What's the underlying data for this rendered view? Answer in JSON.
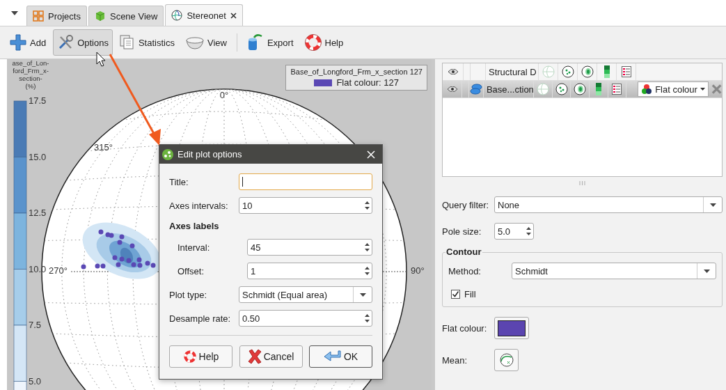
{
  "tabs": [
    {
      "label": "Projects",
      "kind": "projects",
      "selected": false
    },
    {
      "label": "Scene View",
      "kind": "scene",
      "selected": false
    },
    {
      "label": "Stereonet",
      "kind": "stereonet",
      "selected": true
    }
  ],
  "toolbar": [
    {
      "label": "Add",
      "kind": "add",
      "pressed": false
    },
    {
      "label": "Options",
      "kind": "options",
      "pressed": true
    },
    {
      "label": "Statistics",
      "kind": "statistics",
      "pressed": false
    },
    {
      "label": "View",
      "kind": "view",
      "pressed": false
    },
    {
      "label": "Export",
      "kind": "export",
      "pressed": false
    },
    {
      "label": "Help",
      "kind": "help",
      "pressed": false
    }
  ],
  "colorbar": {
    "title_lines": [
      "ase_of_Lon-",
      "ford_Frm_x-",
      "section-",
      "(%)"
    ],
    "ticks": [
      "17.5",
      "15.0",
      "12.5",
      "10.0",
      "7.5",
      "5.0"
    ]
  },
  "stereonet": {
    "labels": [
      {
        "text": "0°"
      },
      {
        "text": "315°"
      },
      {
        "text": "270°"
      },
      {
        "text": "90°"
      }
    ]
  },
  "legend": {
    "title": "Base_of_Longford_Frm_x_section 127",
    "entry": "Flat colour: 127",
    "color": "#5a48b4"
  },
  "layers": [
    {
      "kind": "group",
      "name": "Structural D",
      "selected": false
    },
    {
      "kind": "object",
      "name": "Base...ction",
      "selected": true,
      "colour_mode": "Flat colour"
    }
  ],
  "properties": {
    "query_filter": {
      "label": "Query filter:",
      "value": "None"
    },
    "pole_size": {
      "label": "Pole size:",
      "value": "5.0"
    },
    "contour": {
      "title": "Contour",
      "method_label": "Method:",
      "method": "Schmidt",
      "fill_label": "Fill",
      "fill_checked": true
    },
    "flat_colour": {
      "label": "Flat colour:",
      "color": "#5b45b0"
    },
    "mean": {
      "label": "Mean:"
    }
  },
  "dialog": {
    "title": "Edit plot options",
    "fields": [
      {
        "kind": "text",
        "label": "Title:",
        "focused": true
      },
      {
        "kind": "spin",
        "label": "Axes intervals:",
        "value": "10"
      },
      {
        "kind": "heading",
        "label": "Axes labels",
        "children": [
          {
            "kind": "spin",
            "label": "Interval:",
            "value": "45"
          },
          {
            "kind": "spin",
            "label": "Offset:",
            "value": "1"
          }
        ]
      },
      {
        "kind": "select",
        "label": "Plot type:",
        "value": "Schmidt (Equal area)"
      },
      {
        "kind": "spin",
        "label": "Desample rate:",
        "value": "0.50"
      }
    ],
    "buttons": [
      {
        "label": "Help",
        "kind": "help",
        "default": false
      },
      {
        "label": "Cancel",
        "kind": "cancel",
        "default": false
      },
      {
        "label": "OK",
        "kind": "ok",
        "default": true
      }
    ]
  }
}
